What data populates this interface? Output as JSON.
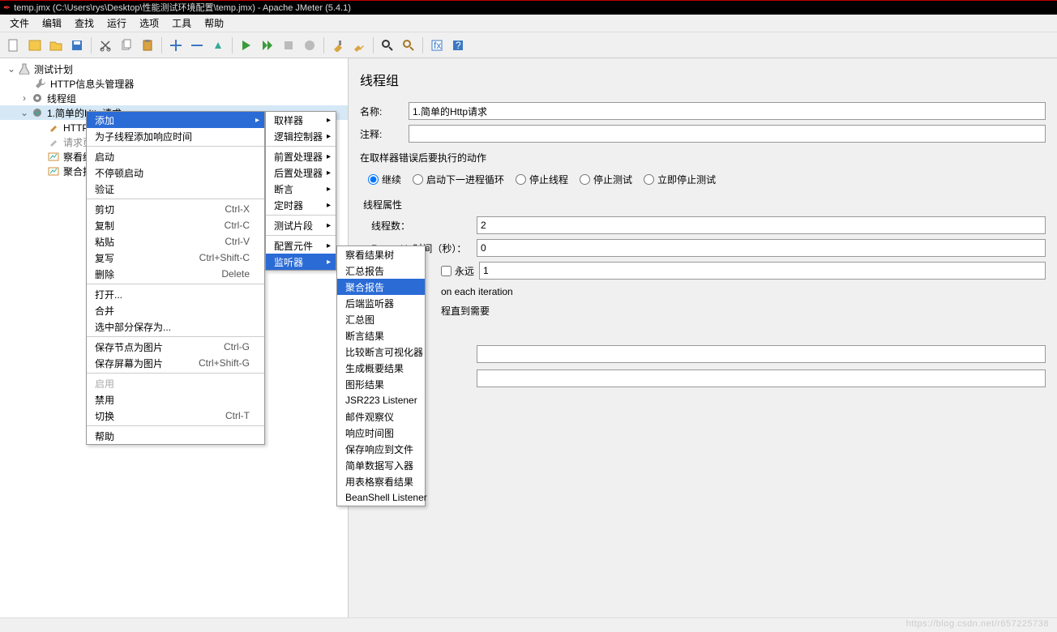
{
  "title": "temp.jmx (C:\\Users\\rys\\Desktop\\性能测试环境配置\\temp.jmx) - Apache JMeter (5.4.1)",
  "menubar": [
    "文件",
    "编辑",
    "查找",
    "运行",
    "选项",
    "工具",
    "帮助"
  ],
  "tree": {
    "root": "测试计划",
    "httpHeaderMgr": "HTTP信息头管理器",
    "threadGroupNode": "线程组",
    "httpReqGroup": "1.简单的Http请求",
    "httpReq": "HTTP请",
    "reqDefaults": "请求页",
    "viewResults": "察看结",
    "aggReport": "聚合报"
  },
  "panel": {
    "heading": "线程组",
    "nameLabel": "名称:",
    "nameValue": "1.简单的Http请求",
    "commentLabel": "注释:",
    "commentValue": "",
    "onErrorLabel": "在取样器错误后要执行的动作",
    "radios": {
      "continue": "继续",
      "startNext": "启动下一进程循环",
      "stopThread": "停止线程",
      "stopTest": "停止测试",
      "stopNow": "立即停止测试"
    },
    "threadPropsLabel": "线程属性",
    "threadsLabel": "线程数：",
    "threadsValue": "2",
    "rampLabel": "Ramp-Up时间（秒）：",
    "rampValue": "0",
    "foreverLabel": "永远",
    "loopValue": "1",
    "sameUserLabel": "on each iteration",
    "delayLabel": "程直到需要",
    "emptyLabel": ""
  },
  "ctx1": {
    "add": "添加",
    "addChildTime": "为子线程添加响应时间",
    "start": "启动",
    "startNoPause": "不停顿启动",
    "validate": "验证",
    "cut": {
      "label": "剪切",
      "key": "Ctrl-X"
    },
    "copy": {
      "label": "复制",
      "key": "Ctrl-C"
    },
    "paste": {
      "label": "粘贴",
      "key": "Ctrl-V"
    },
    "duplicate": {
      "label": "复写",
      "key": "Ctrl+Shift-C"
    },
    "remove": {
      "label": "删除",
      "key": "Delete"
    },
    "open": "打开...",
    "merge": "合并",
    "saveSelAs": "选中部分保存为...",
    "saveNodeImg": {
      "label": "保存节点为图片",
      "key": "Ctrl-G"
    },
    "saveScreenImg": {
      "label": "保存屏幕为图片",
      "key": "Ctrl+Shift-G"
    },
    "enable": "启用",
    "disable": "禁用",
    "toggle": {
      "label": "切换",
      "key": "Ctrl-T"
    },
    "help": "帮助"
  },
  "ctx2": {
    "sampler": "取样器",
    "logicCtrl": "逻辑控制器",
    "preProc": "前置处理器",
    "postProc": "后置处理器",
    "assertion": "断言",
    "timer": "定时器",
    "testFrag": "测试片段",
    "configEl": "配置元件",
    "listener": "监听器"
  },
  "ctx3": {
    "viewResultsTree": "察看结果树",
    "summaryReport": "汇总报告",
    "aggregateReport": "聚合报告",
    "backendListener": "后端监听器",
    "summaryGraph": "汇总图",
    "assertionResults": "断言结果",
    "compAssertVis": "比较断言可视化器",
    "genSummary": "生成概要结果",
    "graphResults": "图形结果",
    "jsr223": "JSR223 Listener",
    "mailer": "邮件观察仪",
    "respTimeGraph": "响应时间图",
    "saveRespFile": "保存响应到文件",
    "simpleDataWriter": "简单数据写入器",
    "tableResults": "用表格察看结果",
    "beanshell": "BeanShell Listener"
  },
  "watermark": "https://blog.csdn.net/r657225738"
}
